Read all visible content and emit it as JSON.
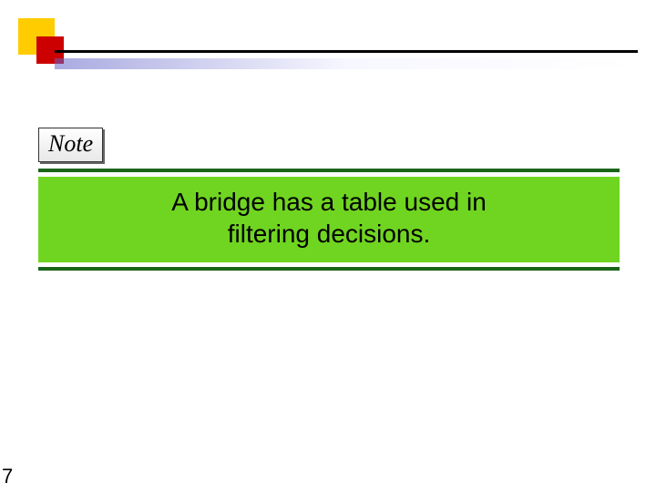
{
  "header": {
    "colors": {
      "square_outer": "#ffcc00",
      "square_inner": "#cc0000"
    }
  },
  "note_chip": {
    "label": "Note"
  },
  "banner": {
    "line1": "A bridge has a table used in",
    "line2": "filtering decisions.",
    "bg": "#70d521",
    "rule": "#1a651a"
  },
  "page_number": "7"
}
